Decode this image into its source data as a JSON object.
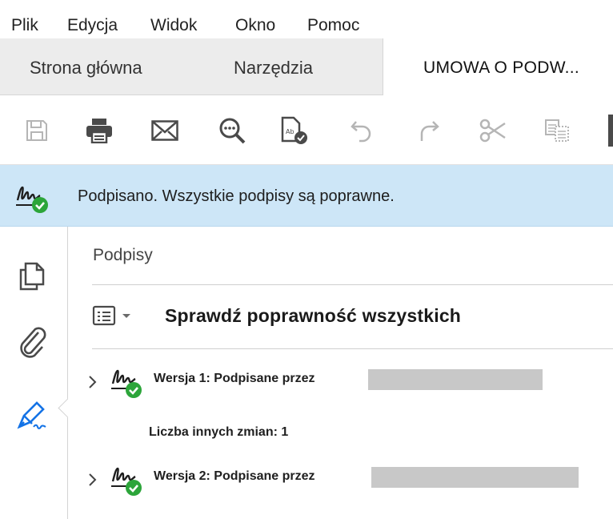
{
  "menu": [
    "Plik",
    "Edycja",
    "Widok",
    "Okno",
    "Pomoc"
  ],
  "tabs": {
    "home": "Strona główna",
    "tools": "Narzędzia",
    "document": "UMOWA O PODW..."
  },
  "toolbar": {
    "icons": [
      "save-icon",
      "print-icon",
      "email-icon",
      "find-icon",
      "edit-pdf-icon",
      "undo-icon",
      "redo-icon",
      "cut-icon",
      "copy-icon"
    ]
  },
  "banner": {
    "message": "Podpisano. Wszystkie podpisy są poprawne.",
    "status_color": "#2ca53a"
  },
  "panel": {
    "title": "Podpisy",
    "validate_all": "Sprawdź poprawność wszystkich",
    "signatures": [
      {
        "label": "Wersja 1: Podpisane przez",
        "expanded": false,
        "signer": ""
      },
      {
        "label": "Wersja 2: Podpisane przez",
        "expanded": false,
        "signer": ""
      }
    ],
    "other_changes": "Liczba innych zmian: 1"
  },
  "colors": {
    "banner_bg": "#cde6f7",
    "accent_blue": "#1473e6",
    "valid_green": "#2ca53a"
  }
}
